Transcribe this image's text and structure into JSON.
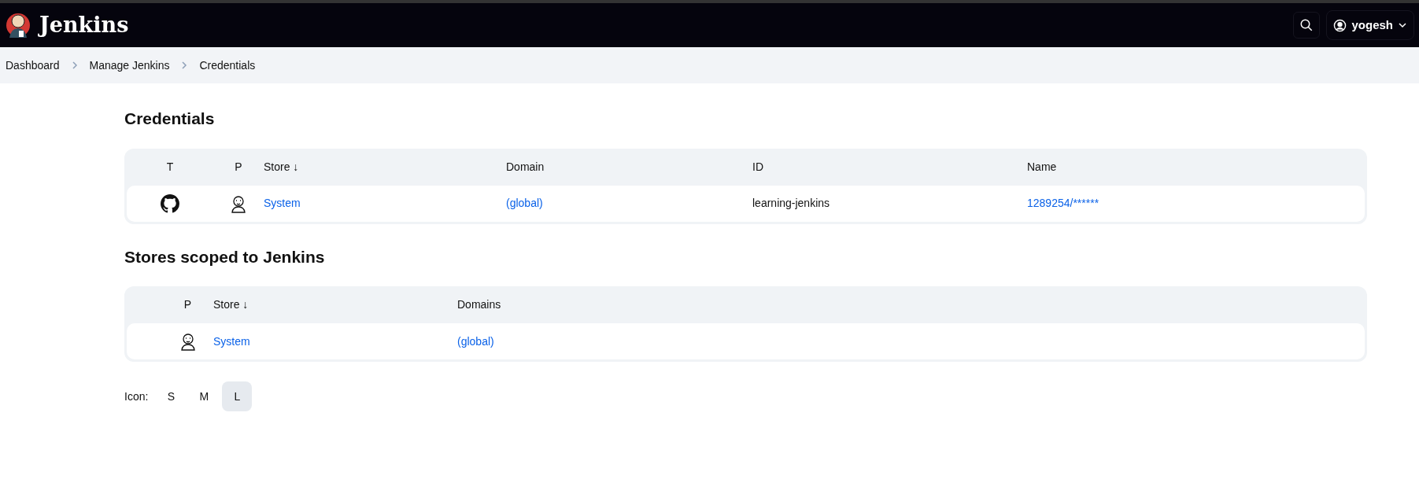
{
  "header": {
    "brand": "Jenkins",
    "user": "yogesh"
  },
  "breadcrumbs": [
    "Dashboard",
    "Manage Jenkins",
    "Credentials"
  ],
  "credentials": {
    "title": "Credentials",
    "columns": [
      "T",
      "P",
      "Store ↓",
      "Domain",
      "ID",
      "Name"
    ],
    "rows": [
      {
        "store": "System",
        "domain": "(global)",
        "id": "learning-jenkins",
        "name": "1289254/******"
      }
    ]
  },
  "stores": {
    "title": "Stores scoped to Jenkins",
    "columns": [
      "P",
      "Store ↓",
      "Domains"
    ],
    "rows": [
      {
        "store": "System",
        "domains": "(global)"
      }
    ]
  },
  "icon_size": {
    "label": "Icon:",
    "options": [
      {
        "label": "S",
        "selected": false
      },
      {
        "label": "M",
        "selected": false
      },
      {
        "label": "L",
        "selected": true
      }
    ]
  }
}
